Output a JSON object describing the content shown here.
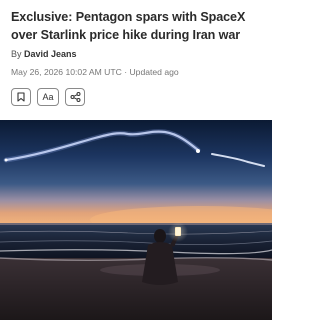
{
  "article": {
    "headline": "Exclusive: Pentagon spars with SpaceX over Starlink price hike during Iran war",
    "byline_prefix": "By ",
    "author": "David Jeans",
    "dateline": "May 26, 2026 10:02 AM UTC · Updated ago"
  },
  "actions": {
    "bookmark_icon": "bookmark-icon",
    "text_size_label": "Aa",
    "share_icon": "share-icon"
  },
  "photo": {
    "subject": "person photographing rocket trail over ocean at dusk"
  }
}
